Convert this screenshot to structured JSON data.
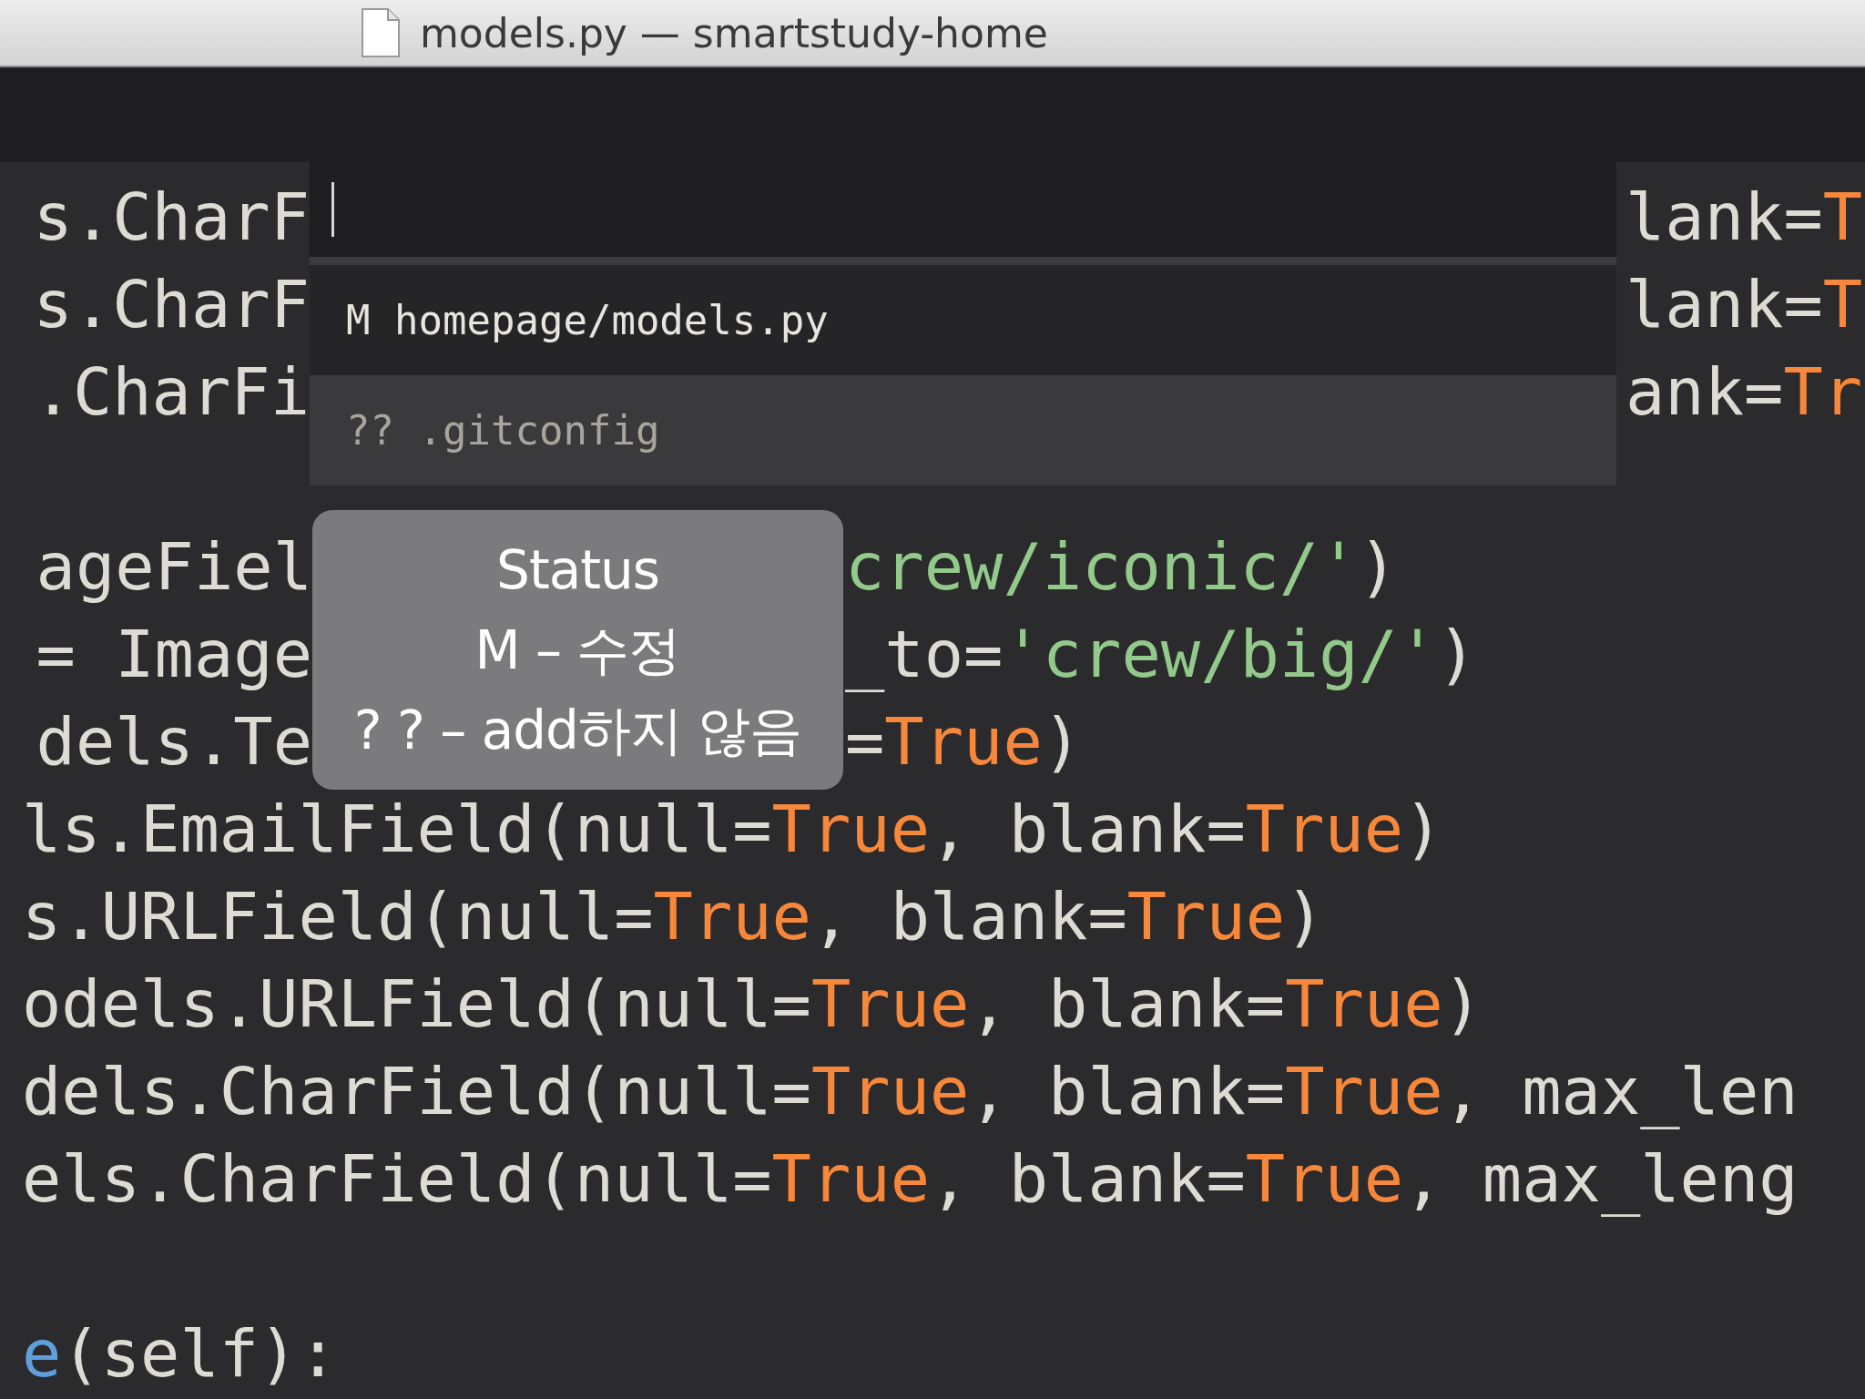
{
  "window": {
    "title": "models.py — smartstudy-home"
  },
  "editor": {
    "lines": [
      {
        "kind": "under_panel",
        "left": [
          {
            "kind": "plain",
            "text": "s.CharF"
          }
        ],
        "right": [
          {
            "kind": "plain",
            "text": "lank="
          },
          {
            "kind": "constant",
            "text": "T"
          }
        ]
      },
      {
        "kind": "under_panel",
        "left": [
          {
            "kind": "plain",
            "text": "s.CharF"
          }
        ],
        "right": [
          {
            "kind": "plain",
            "text": "lank="
          },
          {
            "kind": "constant",
            "text": "T"
          }
        ]
      },
      {
        "kind": "under_panel",
        "left": [
          {
            "kind": "plain",
            "text": ".CharFi"
          }
        ],
        "right": [
          {
            "kind": "plain",
            "text": "ank="
          },
          {
            "kind": "constant",
            "text": "Tr"
          }
        ]
      },
      {
        "kind": "blank"
      },
      {
        "kind": "under_tooltip",
        "left": [
          {
            "kind": "plain",
            "text": "ageFiel"
          }
        ],
        "right": [
          {
            "kind": "string",
            "text": "crew/iconic/'"
          },
          {
            "kind": "plain",
            "text": ")"
          }
        ]
      },
      {
        "kind": "under_tooltip",
        "left": [
          {
            "kind": "plain",
            "text": "= Image"
          }
        ],
        "right": [
          {
            "kind": "plain",
            "text": "_to="
          },
          {
            "kind": "string",
            "text": "'crew/big/'"
          },
          {
            "kind": "plain",
            "text": ")"
          }
        ]
      },
      {
        "kind": "under_tooltip",
        "left": [
          {
            "kind": "plain",
            "text": "dels.Te"
          }
        ],
        "right": [
          {
            "kind": "plain",
            "text": "="
          },
          {
            "kind": "constant",
            "text": "True"
          },
          {
            "kind": "plain",
            "text": ")"
          }
        ]
      },
      {
        "kind": "code",
        "left": [
          {
            "kind": "plain",
            "text": "ls.EmailField(null="
          },
          {
            "kind": "constant",
            "text": "True"
          },
          {
            "kind": "plain",
            "text": ", blank="
          },
          {
            "kind": "constant",
            "text": "True"
          },
          {
            "kind": "plain",
            "text": ")"
          }
        ]
      },
      {
        "kind": "code",
        "left": [
          {
            "kind": "plain",
            "text": "s.URLField(null="
          },
          {
            "kind": "constant",
            "text": "True"
          },
          {
            "kind": "plain",
            "text": ", blank="
          },
          {
            "kind": "constant",
            "text": "True"
          },
          {
            "kind": "plain",
            "text": ")"
          }
        ]
      },
      {
        "kind": "code",
        "left": [
          {
            "kind": "plain",
            "text": "odels.URLField(null="
          },
          {
            "kind": "constant",
            "text": "True"
          },
          {
            "kind": "plain",
            "text": ", blank="
          },
          {
            "kind": "constant",
            "text": "True"
          },
          {
            "kind": "plain",
            "text": ")"
          }
        ]
      },
      {
        "kind": "code",
        "left": [
          {
            "kind": "plain",
            "text": "dels.CharField(null="
          },
          {
            "kind": "constant",
            "text": "True"
          },
          {
            "kind": "plain",
            "text": ", blank="
          },
          {
            "kind": "constant",
            "text": "True"
          },
          {
            "kind": "plain",
            "text": ", max_len"
          }
        ]
      },
      {
        "kind": "code",
        "left": [
          {
            "kind": "plain",
            "text": "els.CharField(null="
          },
          {
            "kind": "constant",
            "text": "True"
          },
          {
            "kind": "plain",
            "text": ", blank="
          },
          {
            "kind": "constant",
            "text": "True"
          },
          {
            "kind": "plain",
            "text": ", max_leng"
          }
        ]
      },
      {
        "kind": "blank"
      },
      {
        "kind": "code",
        "left": [
          {
            "kind": "function",
            "text": "e"
          },
          {
            "kind": "plain",
            "text": "(self):"
          }
        ]
      }
    ]
  },
  "quick_panel": {
    "items": [
      {
        "label": "M homepage/models.py",
        "selected": true
      },
      {
        "label": "?? .gitconfig",
        "selected": false
      }
    ]
  },
  "tooltip": {
    "lines": [
      "Status",
      "M – 수정",
      "? ? – add하지 않음"
    ]
  }
}
